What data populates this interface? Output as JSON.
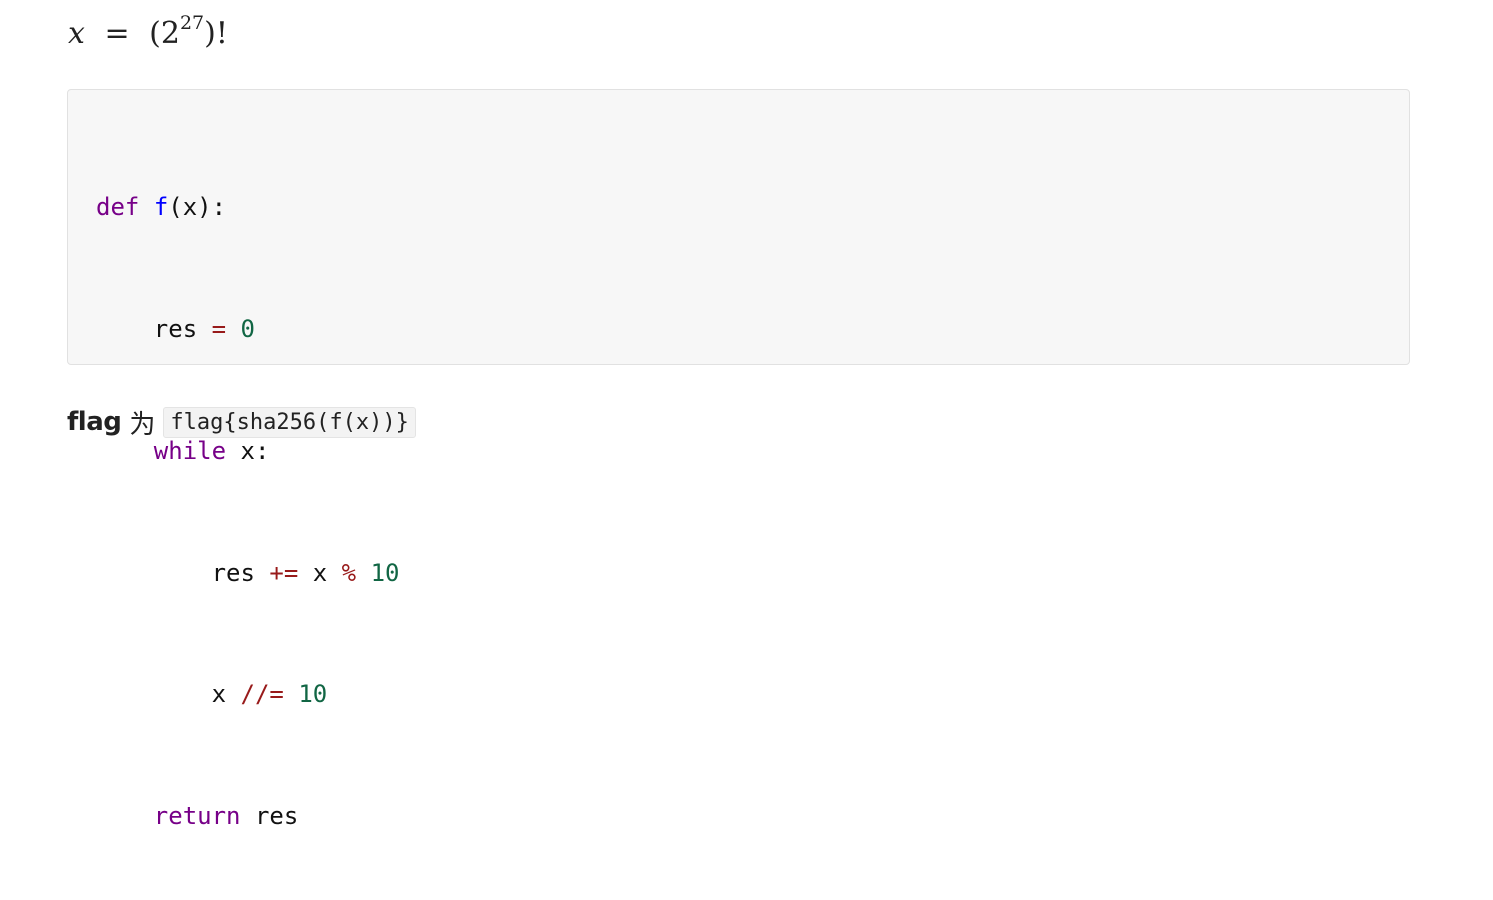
{
  "math": {
    "lhs": "x",
    "eq": "=",
    "open": "(",
    "base": "2",
    "exp": "27",
    "close": ")!"
  },
  "code": {
    "line1": {
      "kw": "def",
      "sp": " ",
      "fn": "f",
      "rest": "(x):"
    },
    "line2": {
      "indent": "    ",
      "a": "res",
      "s1": " ",
      "op": "=",
      "s2": " ",
      "num": "0"
    },
    "line3": {
      "indent": "    ",
      "kw": "while",
      "rest": " x:"
    },
    "line4": {
      "indent": "        ",
      "a": "res",
      "s1": " ",
      "op1": "+=",
      "s2": " ",
      "b": "x",
      "s3": " ",
      "op2": "%",
      "s4": " ",
      "num": "10"
    },
    "line5": {
      "indent": "        ",
      "a": "x",
      "s1": " ",
      "op": "//=",
      "s2": " ",
      "num": "10"
    },
    "line6": {
      "indent": "    ",
      "kw": "return",
      "rest": " res"
    }
  },
  "flag": {
    "label": "flag",
    "connector": "为",
    "code": "flag{sha256(f(x))}"
  }
}
